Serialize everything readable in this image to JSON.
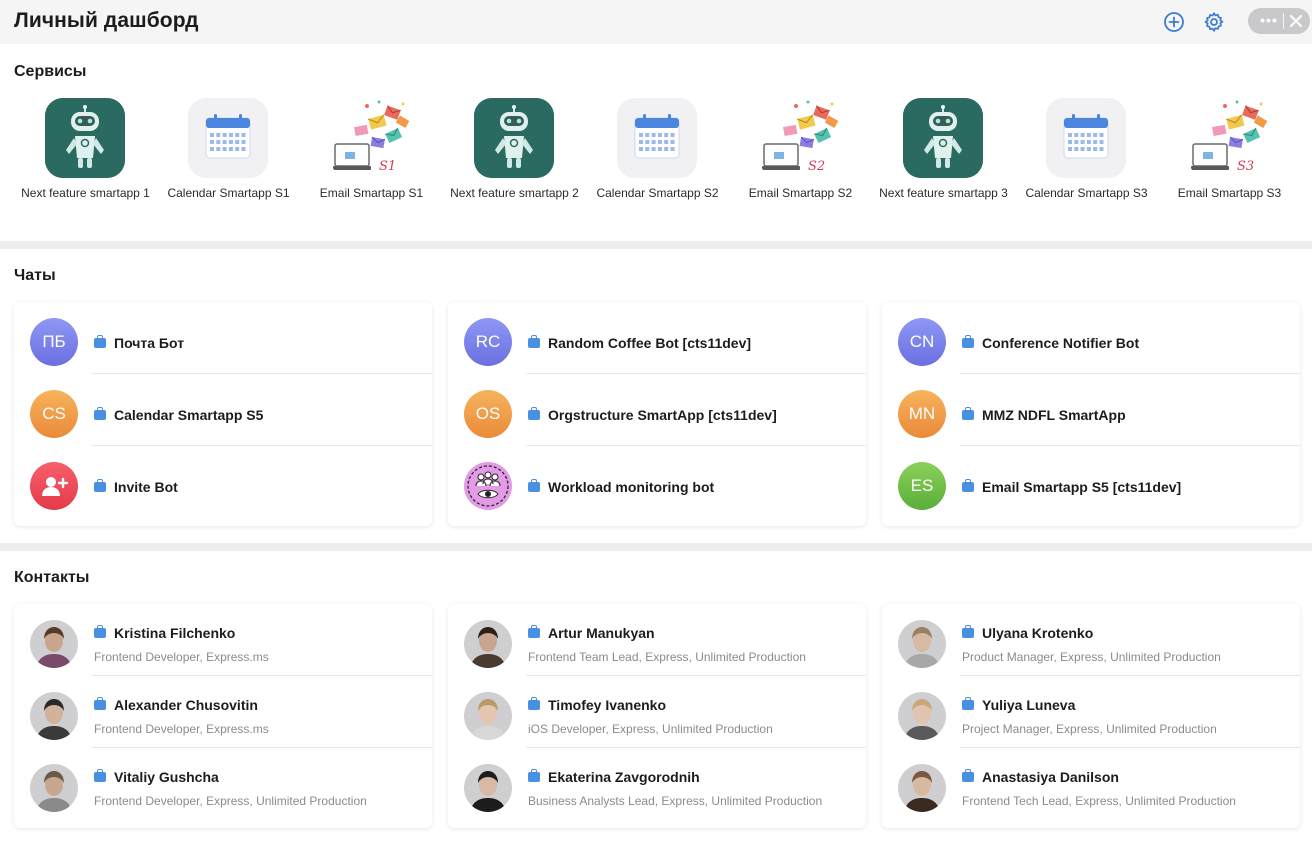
{
  "header": {
    "title": "Личный дашборд"
  },
  "sections": {
    "services_title": "Сервисы",
    "chats_title": "Чаты",
    "contacts_title": "Контакты"
  },
  "services": [
    {
      "label": "Next feature smartapp 1",
      "icon": "robot-icon"
    },
    {
      "label": "Calendar Smartapp S1",
      "icon": "calendar-icon"
    },
    {
      "label": "Email Smartapp S1",
      "icon": "email-icon",
      "tag": "S1"
    },
    {
      "label": "Next feature smartapp 2",
      "icon": "robot-icon"
    },
    {
      "label": "Calendar Smartapp S2",
      "icon": "calendar-icon"
    },
    {
      "label": "Email Smartapp S2",
      "icon": "email-icon",
      "tag": "S2"
    },
    {
      "label": "Next feature smartapp 3",
      "icon": "robot-icon"
    },
    {
      "label": "Calendar Smartapp S3",
      "icon": "calendar-icon"
    },
    {
      "label": "Email Smartapp S3",
      "icon": "email-icon",
      "tag": "S3"
    }
  ],
  "chats": [
    [
      {
        "initials": "ПБ",
        "name": "Почта Бот",
        "color": "purple"
      },
      {
        "initials": "CS",
        "name": "Calendar Smartapp S5",
        "color": "orange"
      },
      {
        "initials": "",
        "name": "Invite Bot",
        "color": "red",
        "icon": "add-user-icon"
      }
    ],
    [
      {
        "initials": "RC",
        "name": "Random Coffee Bot [cts11dev]",
        "color": "purple"
      },
      {
        "initials": "OS",
        "name": "Orgstructure SmartApp [cts11dev]",
        "color": "orange"
      },
      {
        "initials": "",
        "name": "Workload monitoring bot",
        "color": "pink",
        "icon": "team-eye-icon"
      }
    ],
    [
      {
        "initials": "CN",
        "name": "Conference Notifier Bot",
        "color": "purple"
      },
      {
        "initials": "MN",
        "name": "MMZ NDFL SmartApp",
        "color": "orange"
      },
      {
        "initials": "ES",
        "name": "Email Smartapp S5 [cts11dev]",
        "color": "green"
      }
    ]
  ],
  "contacts": [
    [
      {
        "name": "Kristina Filchenko",
        "role": "Frontend Developer, Express.ms"
      },
      {
        "name": "Alexander Chusovitin",
        "role": "Frontend Developer, Express.ms"
      },
      {
        "name": "Vitaliy Gushcha",
        "role": "Frontend Developer, Express, Unlimited Production"
      }
    ],
    [
      {
        "name": "Artur Manukyan",
        "role": "Frontend Team Lead, Express, Unlimited Production"
      },
      {
        "name": "Timofey Ivanenko",
        "role": "iOS Developer, Express, Unlimited Production"
      },
      {
        "name": "Ekaterina Zavgorodnih",
        "role": "Business Analysts Lead, Express, Unlimited Production"
      }
    ],
    [
      {
        "name": "Ulyana Krotenko",
        "role": "Product Manager, Express, Unlimited Production"
      },
      {
        "name": "Yuliya Luneva",
        "role": "Project Manager, Express, Unlimited Production"
      },
      {
        "name": "Anastasiya Danilson",
        "role": "Frontend Tech Lead, Express, Unlimited Production"
      }
    ]
  ],
  "colors": {
    "accent": "#4a90e2",
    "robot_bg": "#2a6a60",
    "header_bg": "#f5f5f6"
  }
}
